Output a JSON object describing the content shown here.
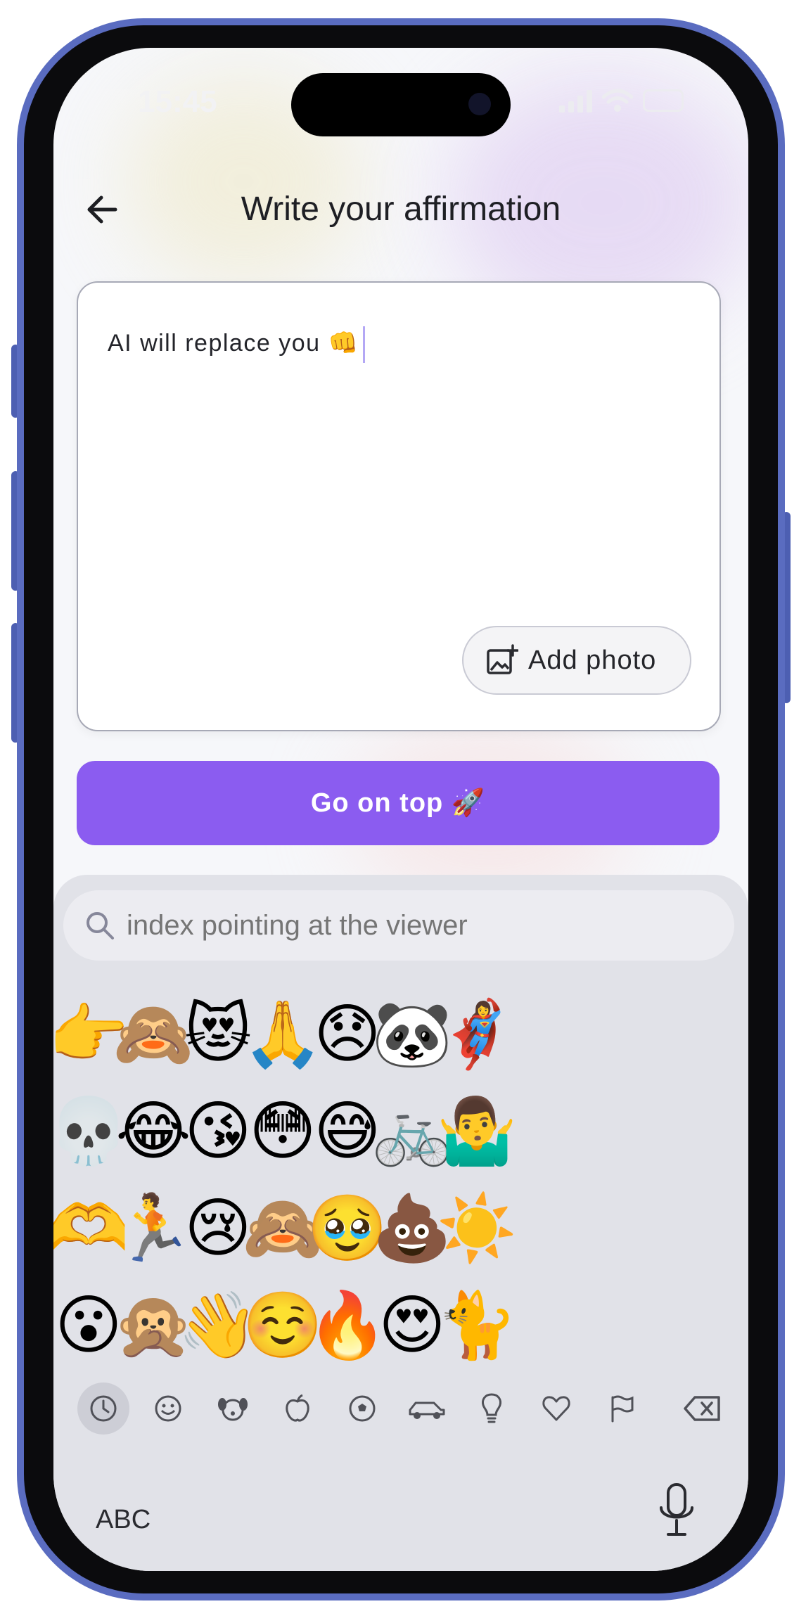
{
  "status_bar": {
    "time": "15:45"
  },
  "header": {
    "title": "Write your affirmation"
  },
  "editor": {
    "text": "AI will replace you 👊",
    "add_photo_label": "Add photo"
  },
  "cta": {
    "label": "Go on top 🚀"
  },
  "keyboard": {
    "search_placeholder": "index pointing at the viewer",
    "emoji_rows": [
      [
        "👉",
        "🙈",
        "😻",
        "🙏",
        "😞",
        "🐼",
        "🦸‍♀️"
      ],
      [
        "💀",
        "😂",
        "😘",
        "😳",
        "😅",
        "🚲",
        "🤷‍♂️"
      ],
      [
        "🫶",
        "🏃",
        "😢",
        "🙈",
        "🥹",
        "💩",
        "☀️"
      ],
      [
        "😮",
        "🙊",
        "👋",
        "☺️",
        "🔥",
        "😍",
        "🐈"
      ]
    ],
    "categories": [
      "recent-icon",
      "smiley-icon",
      "animal-icon",
      "food-icon",
      "sports-icon",
      "travel-icon",
      "objects-icon",
      "symbols-icon",
      "flags-icon"
    ],
    "abc_label": "ABC"
  },
  "colors": {
    "accent": "#8B5CF0",
    "keyboard_bg": "#E1E2E8",
    "frame": "#5A6CC0"
  }
}
